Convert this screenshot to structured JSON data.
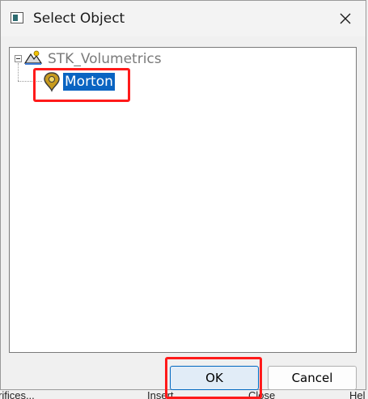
{
  "dialog": {
    "title": "Select Object",
    "close_icon": "close-icon",
    "app_icon": "window-app-icon"
  },
  "tree": {
    "root": {
      "label": "STK_Volumetrics",
      "icon": "scenario-icon",
      "expanded": true
    },
    "children": [
      {
        "label": "Morton",
        "icon": "place-pin-icon",
        "selected": true
      }
    ]
  },
  "buttons": {
    "ok_label": "OK",
    "cancel_label": "Cancel"
  },
  "background_toolbar": {
    "items": [
      "rifices...",
      "Insert...",
      "Close",
      "Hel"
    ]
  },
  "colors": {
    "selection": "#0a64c2",
    "highlight": "#ff1a1a",
    "ok_border": "#0067c0"
  }
}
